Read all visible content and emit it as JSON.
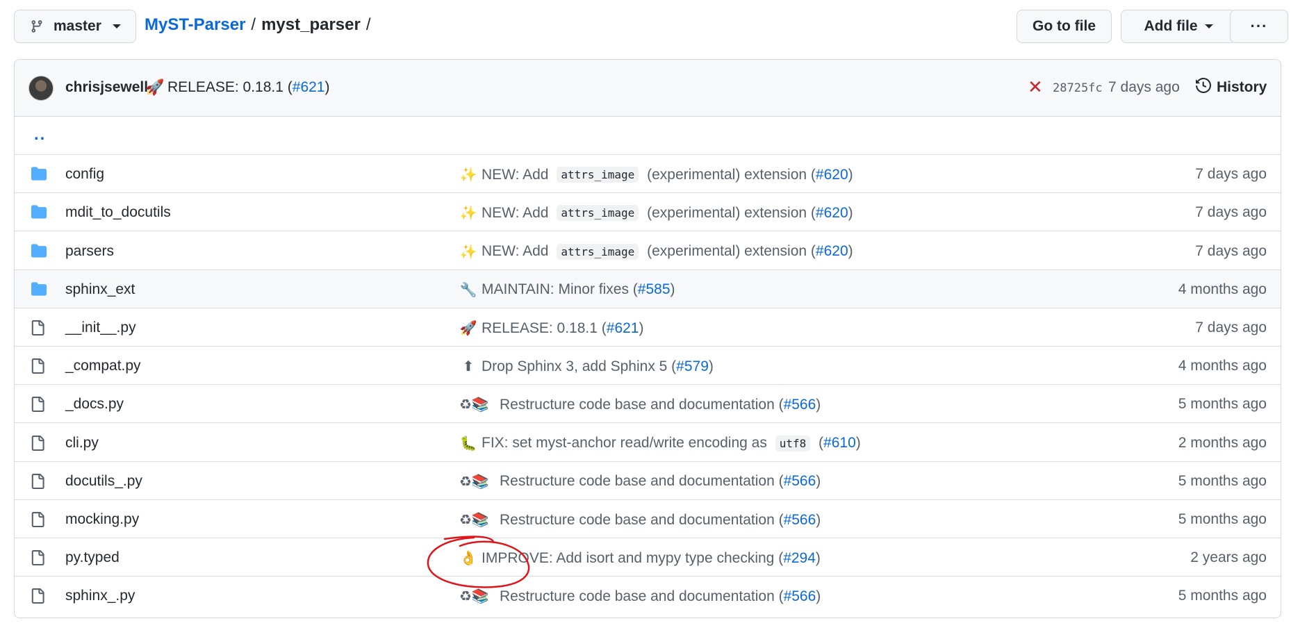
{
  "toolbar": {
    "branch": "master",
    "repo": "MyST-Parser",
    "separator": "/",
    "directory": "myst_parser",
    "trailing_sep": "/",
    "go_to_file": "Go to file",
    "add_file": "Add file",
    "more": "···"
  },
  "latest_commit": {
    "author": "chrisjsewell",
    "emoji": "🚀",
    "message": "RELEASE: 0.18.1 (",
    "pr": "#621",
    "close": ")",
    "status": "✕",
    "sha": "28725fc",
    "age": "7 days ago",
    "history": "History"
  },
  "parent_link": "..",
  "files": [
    {
      "name": "config",
      "type": "dir",
      "emoji": "✨",
      "pre": "NEW: Add ",
      "code": "attrs_image",
      "post": " (experimental) extension (",
      "pr": "#620",
      "close": ")",
      "age": "7 days ago"
    },
    {
      "name": "mdit_to_docutils",
      "type": "dir",
      "emoji": "✨",
      "pre": "NEW: Add ",
      "code": "attrs_image",
      "post": " (experimental) extension (",
      "pr": "#620",
      "close": ")",
      "age": "7 days ago"
    },
    {
      "name": "parsers",
      "type": "dir",
      "emoji": "✨",
      "pre": "NEW: Add ",
      "code": "attrs_image",
      "post": " (experimental) extension (",
      "pr": "#620",
      "close": ")",
      "age": "7 days ago"
    },
    {
      "name": "sphinx_ext",
      "type": "dir",
      "emoji": "🔧",
      "pre": "MAINTAIN: Minor fixes (",
      "code": "",
      "post": "",
      "pr": "#585",
      "close": ")",
      "age": "4 months ago"
    },
    {
      "name": "__init__.py",
      "type": "file",
      "emoji": "🚀",
      "pre": "RELEASE: 0.18.1 (",
      "code": "",
      "post": "",
      "pr": "#621",
      "close": ")",
      "age": "7 days ago"
    },
    {
      "name": "_compat.py",
      "type": "file",
      "emoji": "⬆",
      "pre": "Drop Sphinx 3, add Sphinx 5 (",
      "code": "",
      "post": "",
      "pr": "#579",
      "close": ")",
      "age": "4 months ago"
    },
    {
      "name": "_docs.py",
      "type": "file",
      "emoji": "♻📚",
      "pre": "Restructure code base and documentation (",
      "code": "",
      "post": "",
      "pr": "#566",
      "close": ")",
      "age": "5 months ago"
    },
    {
      "name": "cli.py",
      "type": "file",
      "emoji": "🐛",
      "pre": "FIX: set myst-anchor read/write encoding as ",
      "code": "utf8",
      "post": " (",
      "pr": "#610",
      "close": ")",
      "age": "2 months ago"
    },
    {
      "name": "docutils_.py",
      "type": "file",
      "emoji": "♻📚",
      "pre": "Restructure code base and documentation (",
      "code": "",
      "post": "",
      "pr": "#566",
      "close": ")",
      "age": "5 months ago"
    },
    {
      "name": "mocking.py",
      "type": "file",
      "emoji": "♻📚",
      "pre": "Restructure code base and documentation (",
      "code": "",
      "post": "",
      "pr": "#566",
      "close": ")",
      "age": "5 months ago"
    },
    {
      "name": "py.typed",
      "type": "file",
      "emoji": "👌",
      "pre": "IMPROVE: Add isort and mypy type checking (",
      "code": "",
      "post": "",
      "pr": "#294",
      "close": ")",
      "age": "2 years ago"
    },
    {
      "name": "sphinx_.py",
      "type": "file",
      "emoji": "♻📚",
      "pre": "Restructure code base and documentation (",
      "code": "",
      "post": "",
      "pr": "#566",
      "close": ")",
      "age": "5 months ago"
    }
  ],
  "colors": {
    "link": "#0969da",
    "folder": "#54aeff",
    "status_fail": "#cf222e",
    "annotation": "#e0151b"
  }
}
